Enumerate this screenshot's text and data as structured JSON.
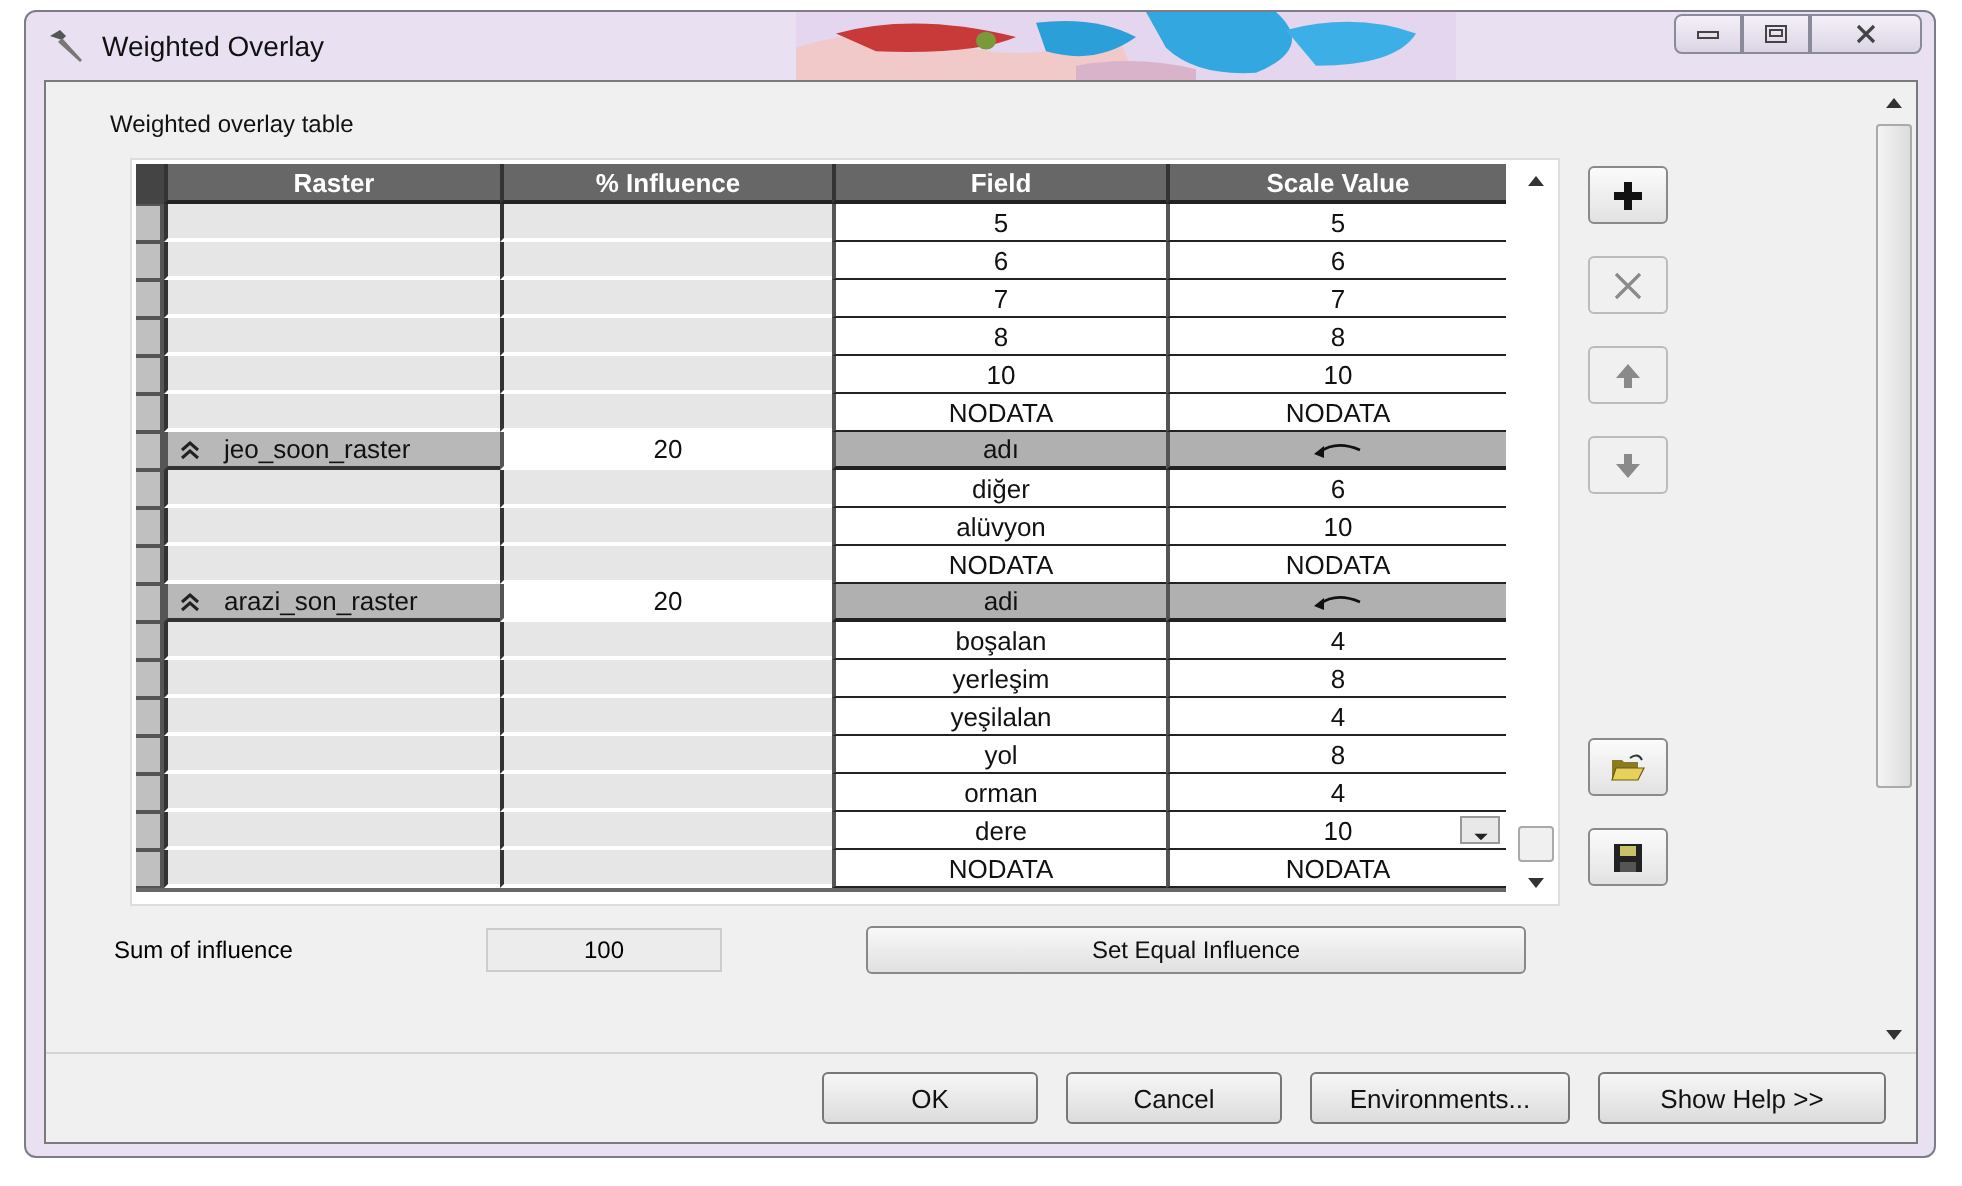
{
  "window": {
    "title": "Weighted Overlay"
  },
  "section_label": "Weighted overlay table",
  "table": {
    "columns": [
      "Raster",
      "% Influence",
      "Field",
      "Scale Value"
    ],
    "rows": [
      {
        "kind": "value",
        "field": "5",
        "scale": "5",
        "editing": false
      },
      {
        "kind": "value",
        "field": "6",
        "scale": "6",
        "editing": false
      },
      {
        "kind": "value",
        "field": "7",
        "scale": "7",
        "editing": false
      },
      {
        "kind": "value",
        "field": "8",
        "scale": "8",
        "editing": false
      },
      {
        "kind": "value",
        "field": "10",
        "scale": "10",
        "editing": false
      },
      {
        "kind": "value",
        "field": "NODATA",
        "scale": "NODATA",
        "editing": false
      },
      {
        "kind": "raster",
        "raster": "jeo_soon_raster",
        "influence": "20",
        "field": "adı"
      },
      {
        "kind": "value",
        "field": "diğer",
        "scale": "6",
        "editing": false
      },
      {
        "kind": "value",
        "field": "alüvyon",
        "scale": "10",
        "editing": false
      },
      {
        "kind": "value",
        "field": "NODATA",
        "scale": "NODATA",
        "editing": false
      },
      {
        "kind": "raster",
        "raster": "arazi_son_raster",
        "influence": "20",
        "field": "adi"
      },
      {
        "kind": "value",
        "field": "boşalan",
        "scale": "4",
        "editing": false
      },
      {
        "kind": "value",
        "field": "yerleşim",
        "scale": "8",
        "editing": false
      },
      {
        "kind": "value",
        "field": "yeşilalan",
        "scale": "4",
        "editing": false
      },
      {
        "kind": "value",
        "field": "yol",
        "scale": "8",
        "editing": false
      },
      {
        "kind": "value",
        "field": "orman",
        "scale": "4",
        "editing": false
      },
      {
        "kind": "value",
        "field": "dere",
        "scale": "10",
        "editing": true
      },
      {
        "kind": "value",
        "field": "NODATA",
        "scale": "NODATA",
        "editing": false
      }
    ]
  },
  "side_tools": [
    {
      "kind": "add",
      "disabled": false
    },
    {
      "kind": "remove",
      "disabled": true
    },
    {
      "kind": "up",
      "disabled": true
    },
    {
      "kind": "down",
      "disabled": true
    },
    {
      "kind": "open",
      "disabled": false
    },
    {
      "kind": "save",
      "disabled": false
    }
  ],
  "sum": {
    "label": "Sum of influence",
    "value": "100"
  },
  "set_equal_button": "Set Equal Influence",
  "buttons": [
    "OK",
    "Cancel",
    "Environments...",
    "Show Help >>"
  ]
}
